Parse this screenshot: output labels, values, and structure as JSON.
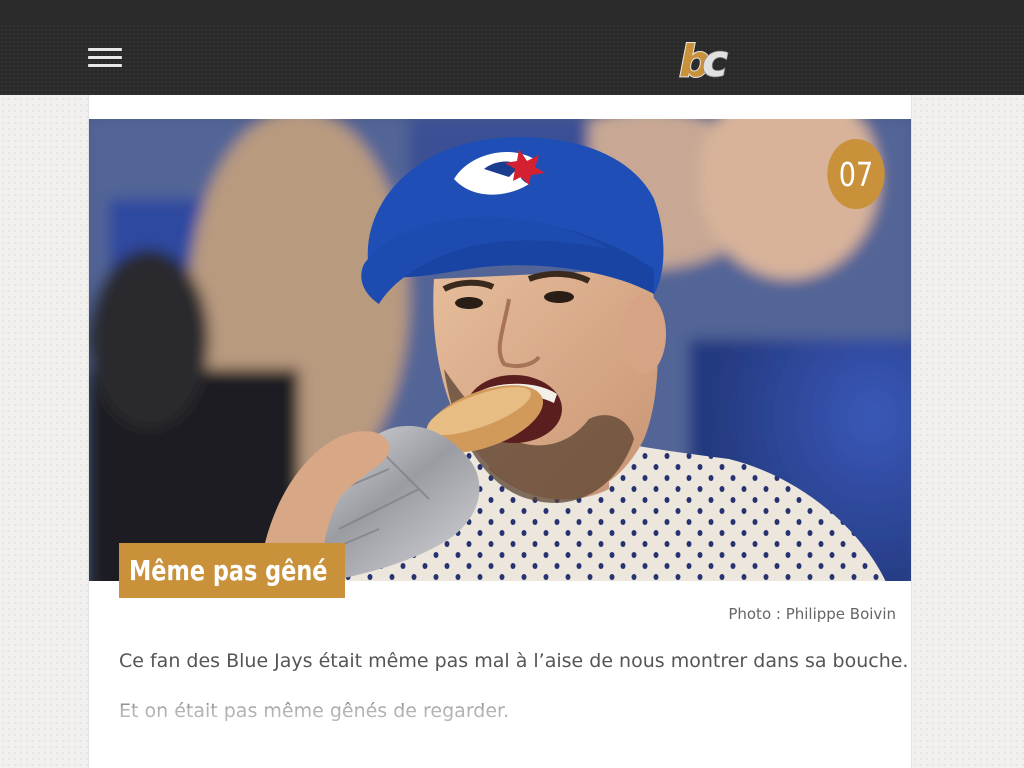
{
  "header": {
    "menu_icon": "hamburger-menu-icon",
    "logo": {
      "text": "bc",
      "colors": {
        "b": "#c8913a",
        "c": "#e1e1e1"
      }
    }
  },
  "colors": {
    "accent": "#c8913a",
    "navbar": "#2a2a2a",
    "topbar": "#2b2b2b"
  },
  "article": {
    "slide_number": "07",
    "title": "Même pas gêné",
    "photo_credit": "Photo : Philippe Boivin",
    "paragraphs": [
      "Ce fan des Blue Jays était même pas mal à l’aise de nous montrer dans sa bouche.",
      "Et on était pas même gênés de regarder."
    ]
  }
}
